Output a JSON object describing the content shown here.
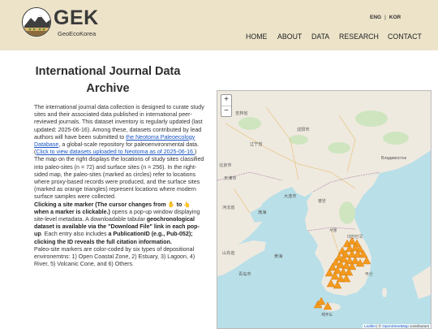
{
  "header": {
    "logo_text": "GEK",
    "logo_subtitle": "GeoEcoKorea",
    "lang_eng": "ENG",
    "lang_sep": "|",
    "lang_kor": "KOR",
    "nav": [
      "HOME",
      "ABOUT",
      "DATA",
      "RESEARCH",
      "CONTACT"
    ]
  },
  "page": {
    "title": "International Journal Data Archive",
    "para1_a": "The international journal data collection is designed to curate study sites and their associated data published in international peer-reviewed journals. This dataset inventory is regularly updated (last updated: 2025-06-16). Among these, datasets contributed by lead authors will have been submitted to ",
    "para1_link1": "the Neotoma Paleoecology Database",
    "para1_b": ", a global-scale repository for paleoenvironmental data. (",
    "para1_link2": "Click to view datasets uploaded to Neotoma as of 2025-06-16.",
    "para1_c": ")",
    "para2": "The map on the right displays the locations of study sites classified into paleo-sites (n = 72) and surface sites (n = 256). In the right-sided map, the paleo-sites (marked as circles) refer to locations where proxy-based records were produced, and the surface sites (marked as orange triangles) represent locations where modern surface samples were collected.",
    "para3_bold1": "Clicking a site marker (The cursor changes from",
    "para3_to": "to",
    "para3_bold2": "when a marker is clickable.)",
    "para3_a": " opens a pop-up window displaying site-level metadata. A downloadable tabular ",
    "para3_bold3": "geochronological dataset is available via the \"Download File\" link in each pop-up",
    "para3_b": ". Each entry also includes ",
    "para3_bold4": "a PublicationID (e.g., Pub-052); clicking the ID reveals the full citation information.",
    "para4": "Paleo-site markers are color-coded by six types of depositional environemtns: 1) Open Coastal Zone, 2) Estuary, 3) Lagoon, 4) River, 5) Volcanic Cone, and 6) Others."
  },
  "map": {
    "zoom_in": "+",
    "zoom_out": "−",
    "attribution_leaflet": "Leaflet",
    "attribution_sep": " | © ",
    "attribution_osm": "OpenStreetMap",
    "attribution_rest": " contributors",
    "marker_color": "#f39a1e",
    "land_color": "#efeae0",
    "water_color": "#b9dfe8",
    "labels": {
      "beijing": "北京市",
      "tianjin": "天津市",
      "shenyang": "沈阳市",
      "dalian": "大连市",
      "pyongyang": "평양",
      "seoul": "서울",
      "korea": "대한민국",
      "jilin": "吉林省",
      "liaoning": "辽宁省",
      "hebei": "河北省",
      "shandong": "山东省",
      "qingdao": "青岛市",
      "bohai": "渤海",
      "yellow_sea": "黄海",
      "vladivostok": "Владивосток",
      "busan": "부산",
      "jeju": "제주도"
    }
  }
}
